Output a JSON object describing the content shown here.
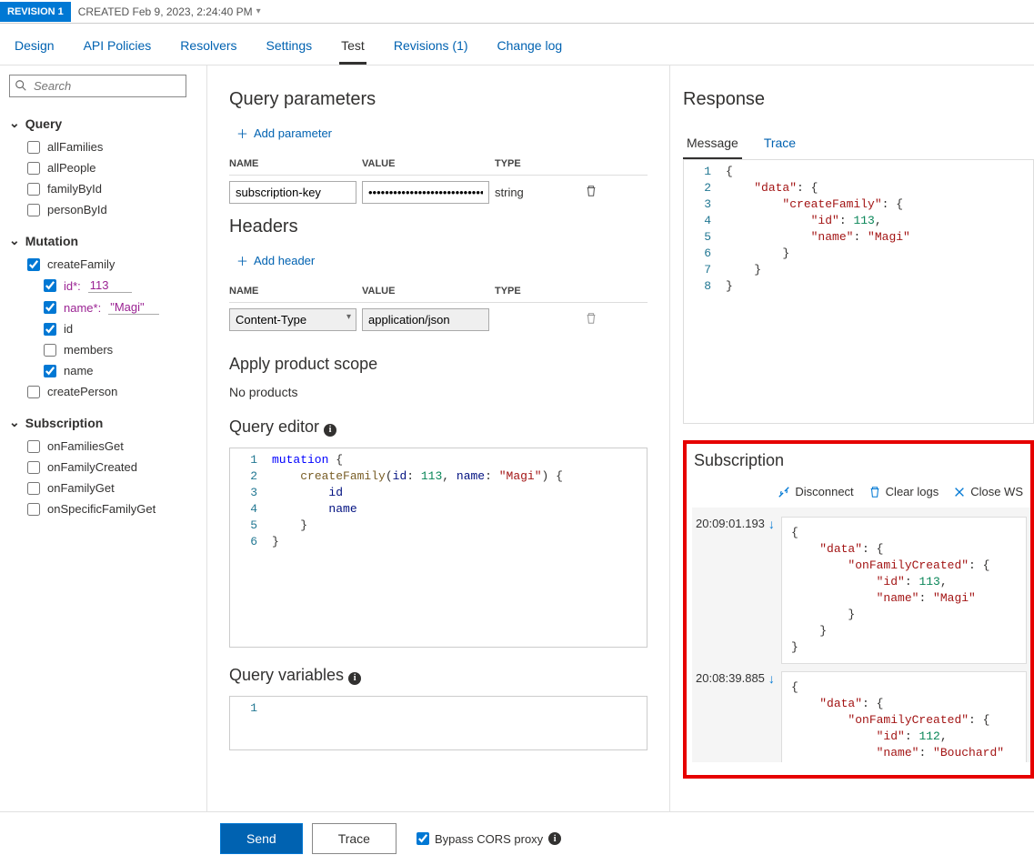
{
  "topbar": {
    "revision_badge": "REVISION 1",
    "created": "CREATED Feb 9, 2023, 2:24:40 PM"
  },
  "tabs": {
    "design": "Design",
    "api_policies": "API Policies",
    "resolvers": "Resolvers",
    "settings": "Settings",
    "test": "Test",
    "revisions": "Revisions (1)",
    "change_log": "Change log"
  },
  "sidebar": {
    "search_placeholder": "Search",
    "groups": {
      "query": {
        "label": "Query",
        "items": {
          "allFamilies": "allFamilies",
          "allPeople": "allPeople",
          "familyById": "familyById",
          "personById": "personById"
        }
      },
      "mutation": {
        "label": "Mutation",
        "items": {
          "createFamily": {
            "label": "createFamily",
            "params": {
              "id": {
                "name": "id*:",
                "value": "113"
              },
              "name": {
                "name": "name*:",
                "value": "\"Magi\""
              }
            },
            "fields": {
              "id": "id",
              "members": "members",
              "name": "name"
            }
          },
          "createPerson": "createPerson"
        }
      },
      "subscription": {
        "label": "Subscription",
        "items": {
          "onFamiliesGet": "onFamiliesGet",
          "onFamilyCreated": "onFamilyCreated",
          "onFamilyGet": "onFamilyGet",
          "onSpecificFamilyGet": "onSpecificFamilyGet"
        }
      }
    }
  },
  "main": {
    "query_params": {
      "title": "Query parameters",
      "add": "Add parameter",
      "head_name": "NAME",
      "head_value": "VALUE",
      "head_type": "TYPE",
      "row1": {
        "name": "subscription-key",
        "value": "••••••••••••••••••••••••••••",
        "type": "string"
      }
    },
    "headers": {
      "title": "Headers",
      "add": "Add header",
      "row1": {
        "name": "Content-Type",
        "value": "application/json"
      }
    },
    "scope": {
      "title": "Apply product scope",
      "none": "No products"
    },
    "editor": {
      "title": "Query editor",
      "lines": [
        "1",
        "2",
        "3",
        "4",
        "5",
        "6"
      ],
      "l1a": "mutation",
      "l1b": " {",
      "l2a": "    ",
      "l2b": "createFamily",
      "l2c": "(",
      "l2d": "id",
      "l2e": ": ",
      "l2f": "113",
      "l2g": ", ",
      "l2h": "name",
      "l2i": ": ",
      "l2j": "\"Magi\"",
      "l2k": ") {",
      "l3": "        id",
      "l4": "        name",
      "l5": "    }",
      "l6": "}"
    },
    "vars": {
      "title": "Query variables",
      "lines": [
        "1"
      ]
    }
  },
  "right": {
    "response": {
      "title": "Response",
      "tab_message": "Message",
      "tab_trace": "Trace",
      "lines": [
        "1",
        "2",
        "3",
        "4",
        "5",
        "6",
        "7",
        "8"
      ],
      "l1": "{",
      "l2a": "    ",
      "l2b": "\"data\"",
      "l2c": ": {",
      "l3a": "        ",
      "l3b": "\"createFamily\"",
      "l3c": ": {",
      "l4a": "            ",
      "l4b": "\"id\"",
      "l4c": ": ",
      "l4d": "113",
      "l4e": ",",
      "l5a": "            ",
      "l5b": "\"name\"",
      "l5c": ": ",
      "l5d": "\"Magi\"",
      "l6": "        }",
      "l7": "    }",
      "l8": "}"
    },
    "subscription": {
      "title": "Subscription",
      "disconnect": "Disconnect",
      "clear": "Clear logs",
      "close": "Close WS",
      "entries": [
        {
          "time": "20:09:01.193",
          "l1": "{",
          "l2a": "    ",
          "l2b": "\"data\"",
          "l2c": ": {",
          "l3a": "        ",
          "l3b": "\"onFamilyCreated\"",
          "l3c": ": {",
          "l4a": "            ",
          "l4b": "\"id\"",
          "l4c": ": ",
          "l4d": "113",
          "l4e": ",",
          "l5a": "            ",
          "l5b": "\"name\"",
          "l5c": ": ",
          "l5d": "\"Magi\"",
          "l6": "        }",
          "l7": "    }",
          "l8": "}"
        },
        {
          "time": "20:08:39.885",
          "l1": "{",
          "l2a": "    ",
          "l2b": "\"data\"",
          "l2c": ": {",
          "l3a": "        ",
          "l3b": "\"onFamilyCreated\"",
          "l3c": ": {",
          "l4a": "            ",
          "l4b": "\"id\"",
          "l4c": ": ",
          "l4d": "112",
          "l4e": ",",
          "l5a": "            ",
          "l5b": "\"name\"",
          "l5c": ": ",
          "l5d": "\"Bouchard\""
        }
      ]
    }
  },
  "footer": {
    "send": "Send",
    "trace": "Trace",
    "bypass": "Bypass CORS proxy"
  }
}
